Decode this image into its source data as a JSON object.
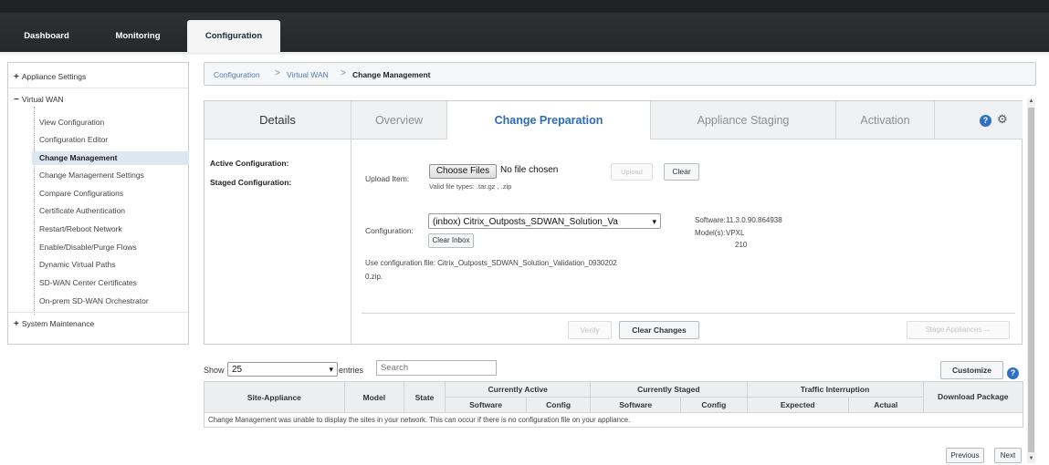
{
  "top_nav": {
    "tabs": [
      "Dashboard",
      "Monitoring",
      "Configuration"
    ],
    "active": "Configuration"
  },
  "sidebar": {
    "sections": [
      {
        "label": "Appliance Settings",
        "toggle": "+"
      },
      {
        "label": "Virtual WAN",
        "toggle": "−"
      },
      {
        "label": "System Maintenance",
        "toggle": "+"
      }
    ],
    "virtual_wan_items": [
      "View Configuration",
      "Configuration Editor",
      "Change Management",
      "Change Management Settings",
      "Compare Configurations",
      "Certificate Authentication",
      "Restart/Reboot Network",
      "Enable/Disable/Purge Flows",
      "Dynamic Virtual Paths",
      "SD-WAN Center Certificates",
      "On-prem SD-WAN Orchestrator"
    ],
    "selected": "Change Management"
  },
  "breadcrumb": {
    "items": [
      "Configuration",
      "Virtual WAN",
      "Change Management"
    ],
    "separator": ">"
  },
  "panel": {
    "tabs": [
      "Details",
      "Overview",
      "Change Preparation",
      "Appliance Staging",
      "Activation"
    ],
    "active_tab": "Change Preparation",
    "details": {
      "active_configuration_label": "Active Configuration:",
      "staged_configuration_label": "Staged Configuration:"
    },
    "upload": {
      "label": "Upload Item:",
      "choose_button": "Choose Files",
      "file_status": "No file chosen",
      "valid_types": "Valid file types: .tar.gz , .zip",
      "upload_button": "Upload",
      "clear_button": "Clear"
    },
    "configuration": {
      "label": "Configuration:",
      "selected": "(inbox) Citrix_Outposts_SDWAN_Solution_Va",
      "clear_inbox_button": "Clear Inbox",
      "software_label": "Software:",
      "software_value": "11.3.0.90.864938",
      "models_label": "Model(s):",
      "models_value_1": "VPXL",
      "models_value_2": "210",
      "use_file_text_1": "Use configuration file: Citrix_Outposts_SDWAN_Solution_Validation_0930202",
      "use_file_text_2": "0.zip."
    },
    "actions": {
      "verify": "Verify",
      "clear_changes": "Clear Changes",
      "stage_appliances": "Stage Appliances →"
    },
    "help_icon_glyph": "?",
    "gear_icon_glyph": "⚙"
  },
  "table_controls": {
    "show_label": "Show",
    "page_size": "25",
    "entries_label": "entries",
    "search_placeholder": "Search",
    "customize_button": "Customize"
  },
  "table": {
    "headers": {
      "site_appliance": "Site-Appliance",
      "model": "Model",
      "state": "State",
      "currently_active": "Currently Active",
      "currently_staged": "Currently Staged",
      "traffic_interruption": "Traffic Interruption",
      "download_package": "Download Package",
      "software": "Software",
      "config": "Config",
      "expected": "Expected",
      "actual": "Actual"
    },
    "empty_message": "Change Management was unable to display the sites in your network. This can occur if there is no configuration file on your appliance."
  },
  "pagination": {
    "previous": "Previous",
    "next": "Next"
  }
}
